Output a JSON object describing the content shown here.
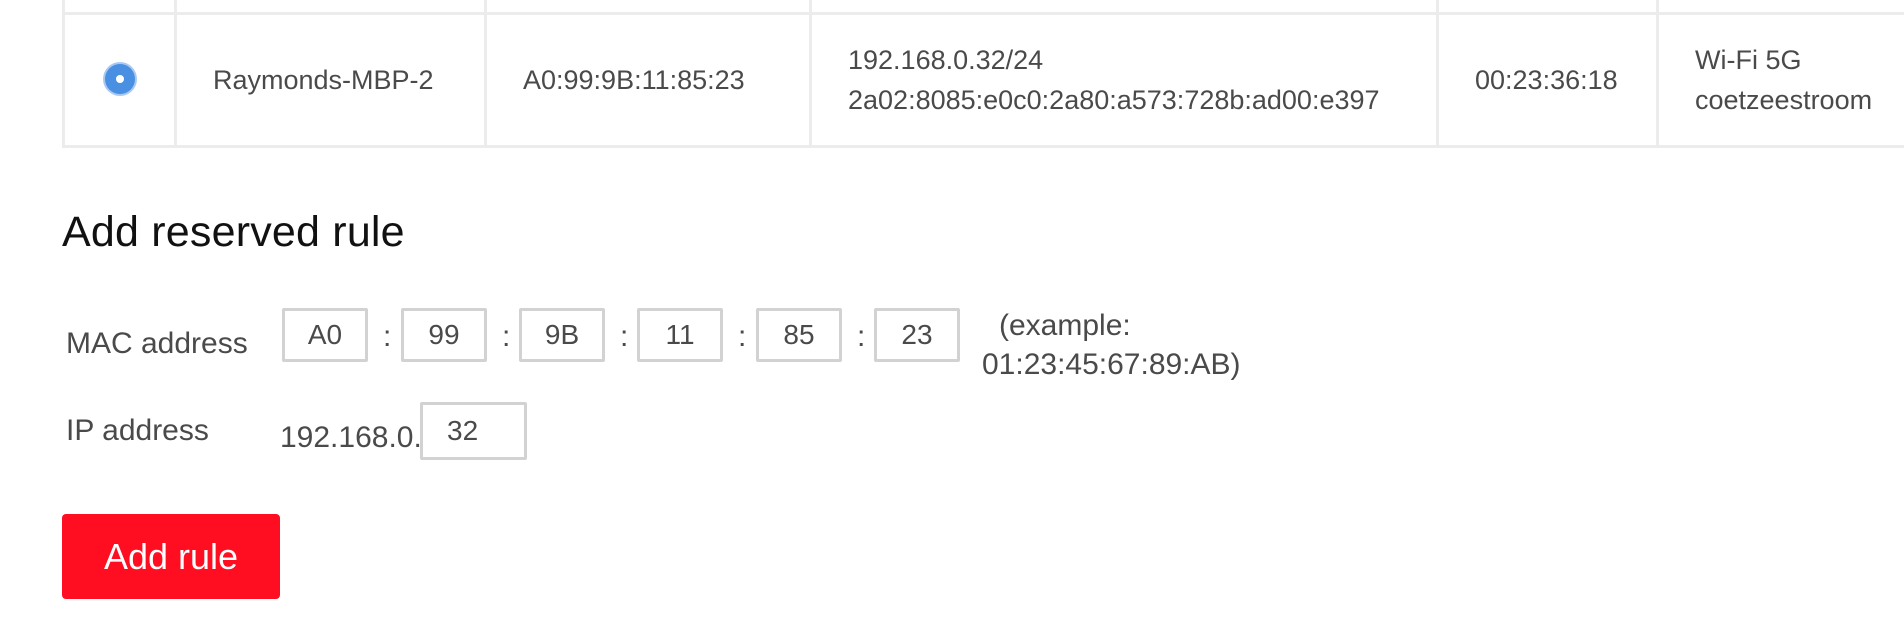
{
  "device_row": {
    "selected": true,
    "hostname": "Raymonds-MBP-2",
    "mac": "A0:99:9B:11:85:23",
    "ipv4": "192.168.0.32/24",
    "ipv6": "2a02:8085:e0c0:2a80:a573:728b:ad00:e397",
    "uptime": "00:23:36:18",
    "connection_type": "Wi-Fi 5G",
    "network_name": "coetzeestroom"
  },
  "add_rule_form": {
    "title": "Add reserved rule",
    "mac_label": "MAC address",
    "mac_octets": [
      "A0",
      "99",
      "9B",
      "11",
      "85",
      "23"
    ],
    "separator": ":",
    "example_line1": "(example:",
    "example_line2": "01:23:45:67:89:AB)",
    "ip_label": "IP address",
    "ip_prefix": "192.168.0.",
    "ip_last_octet": "32",
    "submit_label": "Add rule"
  },
  "colors": {
    "accent_button": "#ff0d21",
    "radio_selected": "#4a90e2",
    "border": "#d2d2d2"
  }
}
